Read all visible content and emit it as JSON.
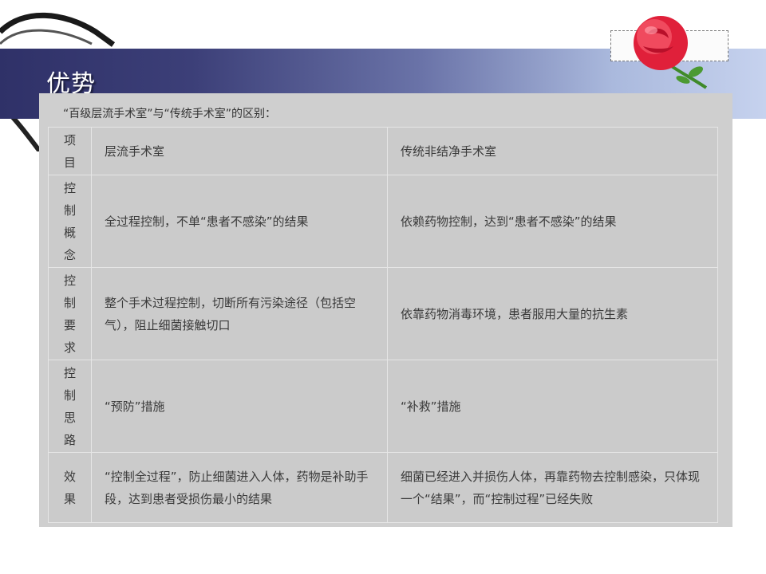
{
  "slide": {
    "title": "优势",
    "caption": "“百级层流手术室”与“传统手术室”的区别："
  },
  "table": {
    "header": {
      "label": "项目",
      "col1": "层流手术室",
      "col2": "传统非结净手术室"
    },
    "rows": [
      {
        "label": "控制概念",
        "col1": "全过程控制，不单“患者不感染”的结果",
        "col2": "依赖药物控制，达到“患者不感染”的结果"
      },
      {
        "label": "控制要求",
        "col1": "整个手术过程控制，切断所有污染途径（包括空气），阻止细菌接触切口",
        "col2": "依靠药物消毒环境，患者服用大量的抗生素"
      },
      {
        "label": "控制思路",
        "col1": "“预防”措施",
        "col2": "“补救”措施"
      },
      {
        "label": "效果",
        "col1": "“控制全过程”，防止细菌进入人体，药物是补助手段，达到患者受损伤最小的结果",
        "col2": "细菌已经进入并损伤人体，再靠药物去控制感染，只体现一个“结果”，而“控制过程”已经失败"
      }
    ]
  },
  "colors": {
    "banner_dark": "#2f3168",
    "banner_light": "#c6d2ee",
    "panel": "#cfcfcf",
    "rose": "#e0203a"
  }
}
